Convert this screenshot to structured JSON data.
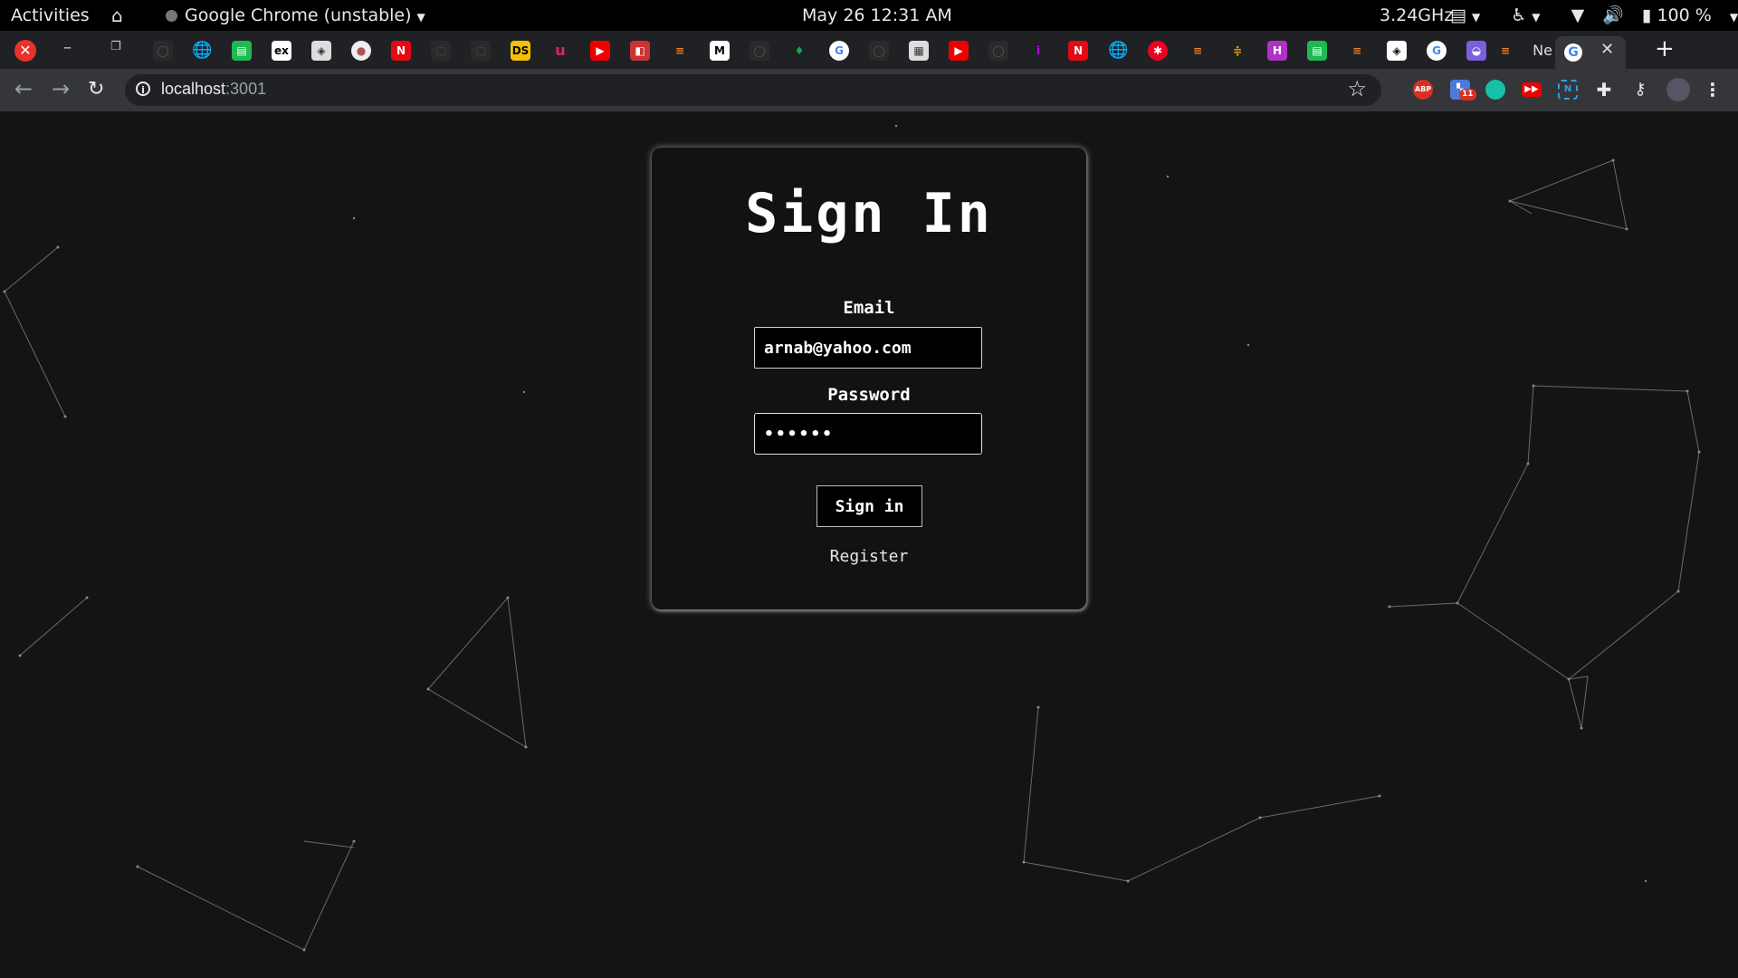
{
  "system_bar": {
    "activities": "Activities",
    "app_name": "Google Chrome (unstable)",
    "clock": "May 26  12:31 AM",
    "cpu_freq": "3.24GHz",
    "battery": "100 %"
  },
  "browser": {
    "url_host": "localhost",
    "url_port": ":3001",
    "last_tab_partial": "Ne",
    "extension_badge": "11"
  },
  "signin": {
    "title": "Sign In",
    "email_label": "Email",
    "email_value": "arnab@yahoo.com",
    "password_label": "Password",
    "password_value": "••••••",
    "submit_label": "Sign in",
    "register_link": "Register"
  },
  "colors": {
    "page_bg": "#141414",
    "card_bg": "#121212",
    "input_bg": "#000000",
    "text": "#ffffff",
    "chrome_dark": "#202124",
    "chrome_toolbar": "#35363a"
  }
}
